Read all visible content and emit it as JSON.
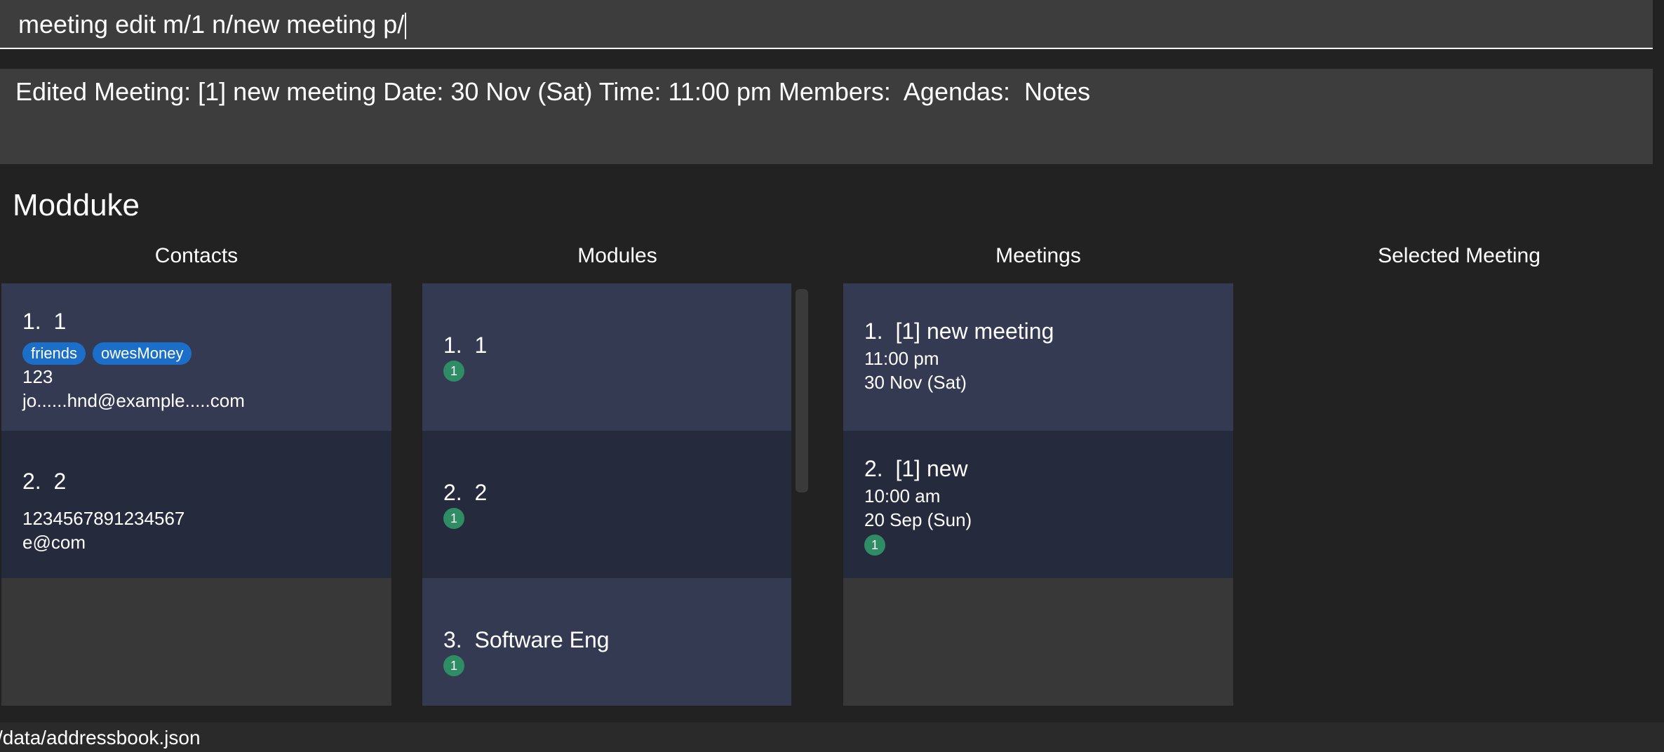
{
  "command": {
    "value": "meeting edit m/1 n/new meeting p/"
  },
  "result": {
    "text": "Edited Meeting: [1] new meeting Date: 30 Nov (Sat) Time: 11:00 pm Members:  Agendas:  Notes"
  },
  "app": {
    "title": "Modduke"
  },
  "headings": {
    "contacts": "Contacts",
    "modules": "Modules",
    "meetings": "Meetings",
    "selected": "Selected Meeting"
  },
  "contacts": [
    {
      "title": "1.  1",
      "tags": [
        "friends",
        "owesMoney"
      ],
      "phone": "123",
      "email": "jo......hnd@example.....com"
    },
    {
      "title": "2.  2",
      "tags": [],
      "phone": "1234567891234567",
      "email": "e@com"
    }
  ],
  "modules": [
    {
      "title": "1.  1",
      "badge": "1"
    },
    {
      "title": "2.  2",
      "badge": "1"
    },
    {
      "title": "3.  Software Eng",
      "badge": "1"
    }
  ],
  "meetings": [
    {
      "title": "1.  [1] new meeting",
      "time": "11:00 pm",
      "date": "30 Nov (Sat)"
    },
    {
      "title": "2.  [1] new",
      "time": "10:00 am",
      "date": "20 Sep (Sun)",
      "badge": "1"
    }
  ],
  "status": {
    "path": "/data/addressbook.json"
  },
  "colors": {
    "background": "#222222",
    "card_light": "#343a52",
    "card_dark": "#262a3d",
    "tag": "#1b6fc9",
    "badge": "#2f8d65"
  }
}
